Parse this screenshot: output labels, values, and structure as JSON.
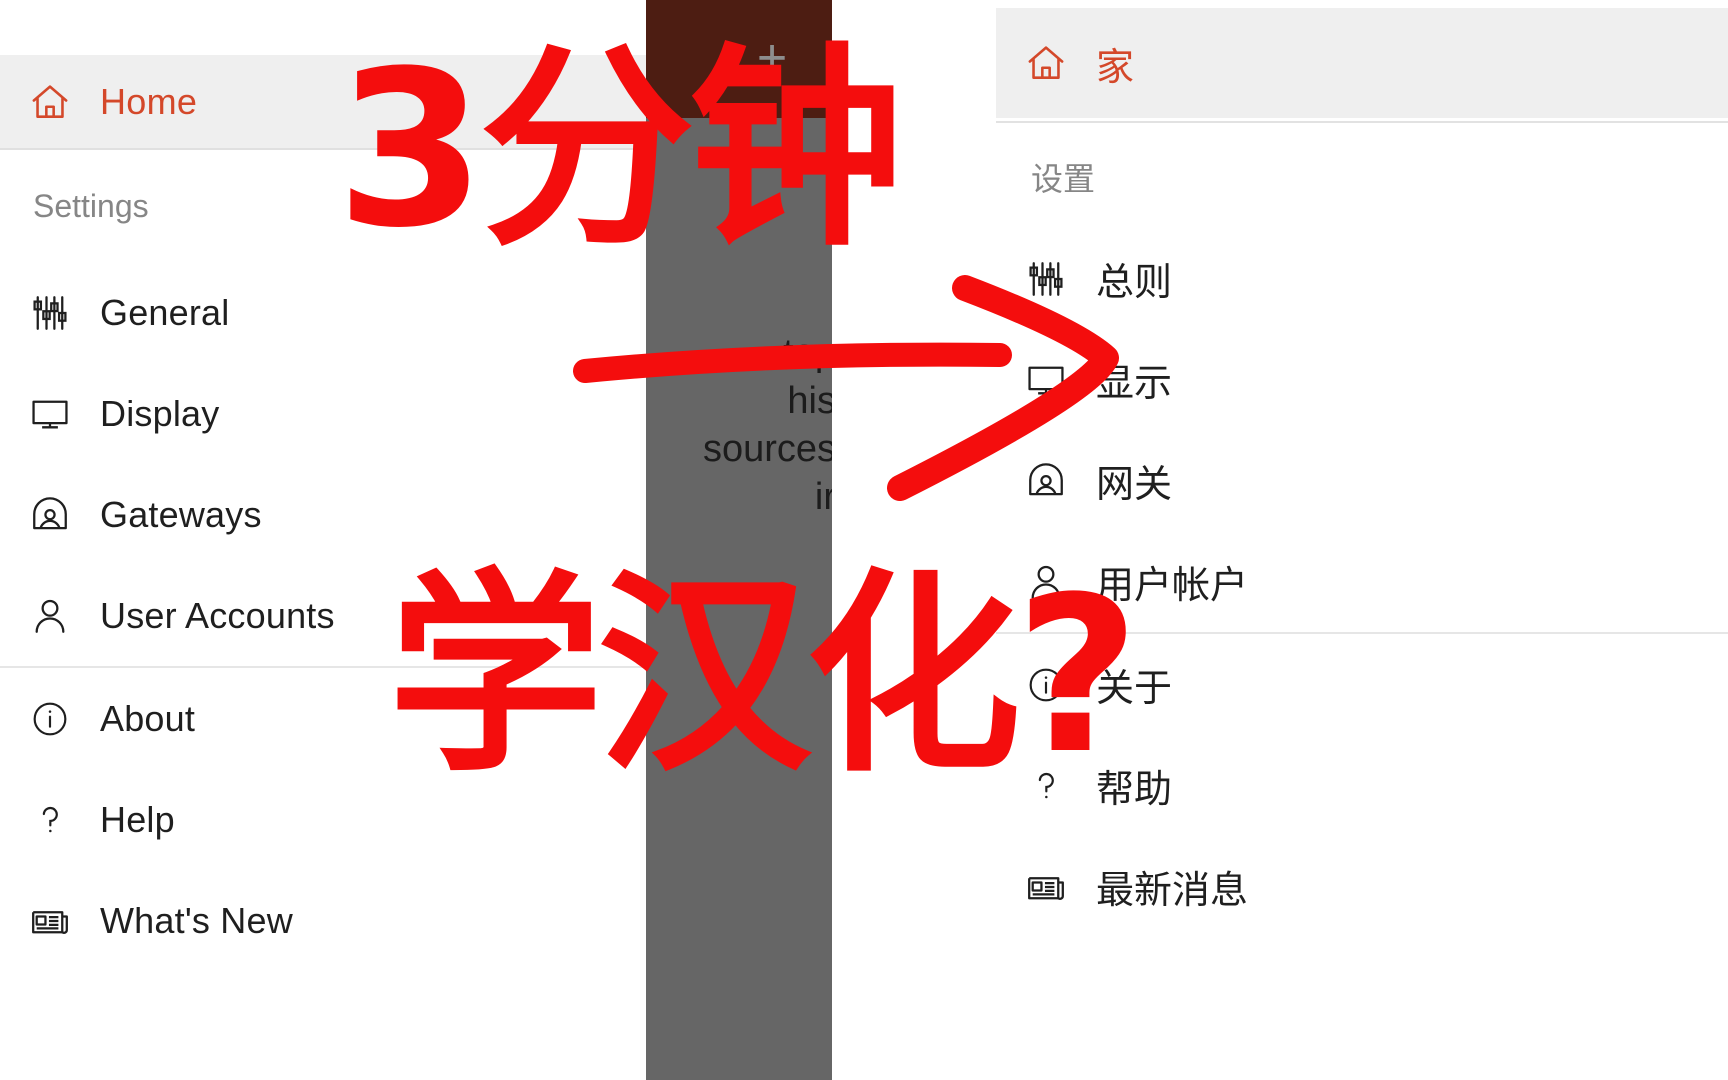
{
  "colors": {
    "accent_orange": "#d4482a",
    "highlight_bg": "#efefef",
    "text_primary": "#1f1f1f",
    "text_muted": "#868686",
    "overlay_gray": "#666666",
    "overlay_header_brown": "#4d1d12",
    "annotation_red": "#f40d0d"
  },
  "left_panel": {
    "home": {
      "label": "Home",
      "icon": "home-icon"
    },
    "section_label": "Settings",
    "items": [
      {
        "label": "General",
        "icon": "sliders-icon"
      },
      {
        "label": "Display",
        "icon": "monitor-icon"
      },
      {
        "label": "Gateways",
        "icon": "gateway-icon"
      },
      {
        "label": "User Accounts",
        "icon": "person-icon"
      },
      {
        "label": "About",
        "icon": "info-icon"
      },
      {
        "label": "Help",
        "icon": "question-icon"
      },
      {
        "label": "What's New",
        "icon": "newspaper-icon"
      }
    ],
    "divider_after_index": 3
  },
  "middle_overlay": {
    "plus_icon": "plus-icon",
    "partial_lines": [
      "top",
      "his",
      "sources",
      "ir"
    ]
  },
  "right_panel": {
    "home": {
      "label": "家",
      "icon": "home-icon"
    },
    "section_label": "设置",
    "items": [
      {
        "label": "总则",
        "icon": "sliders-icon"
      },
      {
        "label": "显示",
        "icon": "monitor-icon"
      },
      {
        "label": "网关",
        "icon": "gateway-icon"
      },
      {
        "label": "用户帐户",
        "icon": "person-icon"
      },
      {
        "label": "关于",
        "icon": "info-icon"
      },
      {
        "label": "帮助",
        "icon": "question-icon"
      },
      {
        "label": "最新消息",
        "icon": "newspaper-icon"
      }
    ],
    "divider_after_index": 3
  },
  "annotation": {
    "line1": "3分钟",
    "line2": "学汉化?",
    "arrow": "arrow-right-annotation"
  }
}
